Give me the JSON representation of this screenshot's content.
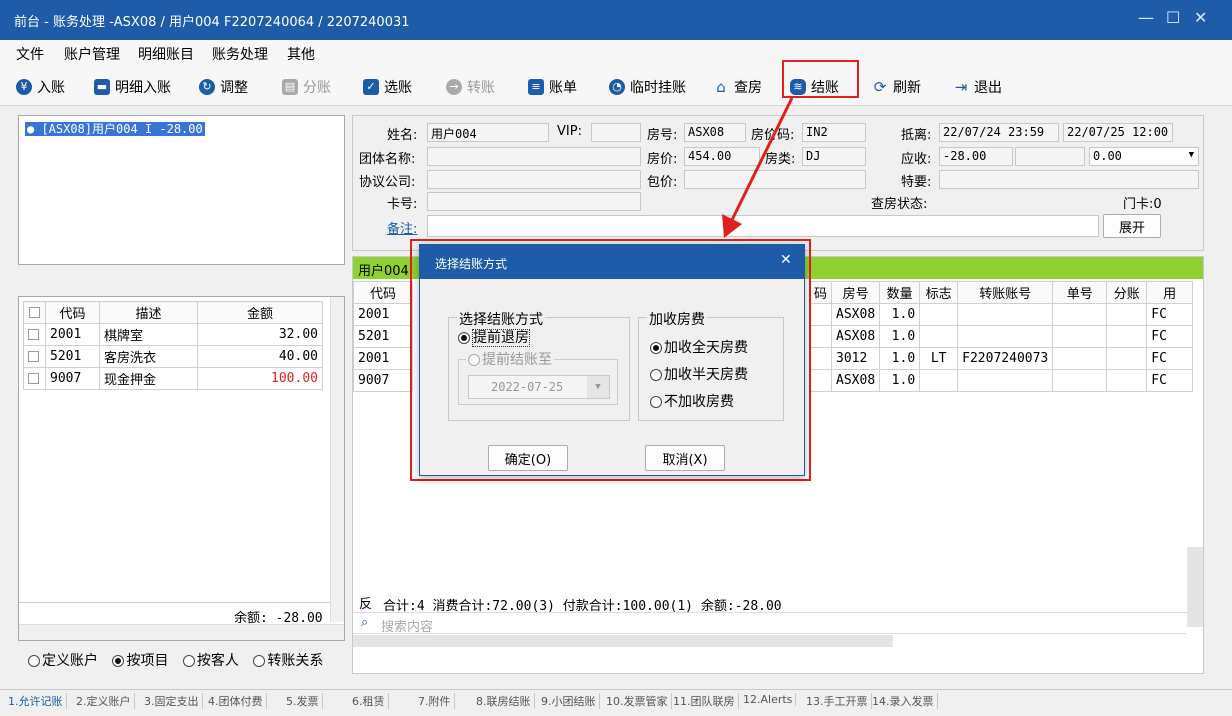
{
  "window": {
    "title": "前台 - 账务处理 -ASX08 / 用户004 F2207240064 / 2207240031",
    "min": "—",
    "max": "☐",
    "close": "✕"
  },
  "menu": [
    "文件",
    "账户管理",
    "明细账目",
    "账务处理",
    "其他"
  ],
  "toolbar": {
    "post": "入账",
    "detail_post": "明细入账",
    "adjust": "调整",
    "split": "分账",
    "select": "选账",
    "transfer": "转账",
    "bill": "账单",
    "temp_hold": "临时挂账",
    "check_room": "查房",
    "checkout": "结账",
    "refresh": "刷新",
    "exit": "退出"
  },
  "account_list": {
    "item": "● [ASX08]用户004         I     -28.00"
  },
  "items_table": {
    "headers": [
      "代码",
      "描述",
      "金额"
    ],
    "rows": [
      {
        "code": "2001",
        "desc": "棋牌室",
        "amount": "32.00"
      },
      {
        "code": "5201",
        "desc": "客房洗衣",
        "amount": "40.00"
      },
      {
        "code": "9007",
        "desc": "现金押金",
        "amount": "100.00"
      }
    ],
    "balance": "余额: -28.00"
  },
  "view_options": [
    "定义账户",
    "按项目",
    "按客人",
    "转账关系"
  ],
  "guest": {
    "name_label": "姓名:",
    "name": "用户004",
    "vip_label": "VIP:",
    "vip": "",
    "room_label": "房号:",
    "room": "ASX08",
    "rate_code_label": "房价码:",
    "rate_code": "IN2",
    "arrival_label": "抵离:",
    "arrival": "22/07/24 23:59",
    "departure": "22/07/25 12:00",
    "group_label": "团体名称:",
    "rate_label": "房价:",
    "rate": "454.00",
    "room_type_label": "房类:",
    "room_type": "DJ",
    "receivable_label": "应收:",
    "receivable": "-28.00",
    "receivable2": "0.00",
    "company_label": "协议公司:",
    "package_label": "包价:",
    "special_label": "特要:",
    "card_label": "卡号:",
    "room_status_label": "查房状态:",
    "door_card": "门卡:0",
    "remark_label": "备注:",
    "expand_button": "展开"
  },
  "transactions": {
    "tab_label": "用户004",
    "headers": [
      "代码",
      "码",
      "房号",
      "数量",
      "标志",
      "转账账号",
      "单号",
      "分账",
      "用"
    ],
    "rows": [
      {
        "code": "2001",
        "room": "ASX08",
        "qty": "1.0",
        "flag": "",
        "transfer": "",
        "end": "FC"
      },
      {
        "code": "5201",
        "room": "ASX08",
        "qty": "1.0",
        "flag": "",
        "transfer": "",
        "end": "FC"
      },
      {
        "code": "2001",
        "room": "3012",
        "qty": "1.0",
        "flag": "LT",
        "transfer": "F2207240073",
        "end": "FC"
      },
      {
        "code": "9007",
        "room": "ASX08",
        "qty": "1.0",
        "flag": "",
        "transfer": "",
        "end": "FC"
      }
    ],
    "summary_prefix": "反",
    "summary": "合计:4  消费合计:72.00(3)  付款合计:100.00(1)  余额:-28.00",
    "search_placeholder": "搜索内容"
  },
  "dialog": {
    "title": "选择结账方式",
    "method_group": "选择结账方式",
    "early_checkout": "提前退房",
    "early_settle": "提前结账至",
    "date": "2022-07-25",
    "fee_group": "加收房费",
    "fee_full": "加收全天房费",
    "fee_half": "加收半天房费",
    "fee_none": "不加收房费",
    "ok": "确定(O)",
    "cancel": "取消(X)"
  },
  "bottom_tabs": [
    "1.允许记账",
    "2.定义账户",
    "3.固定支出",
    "4.团体付费",
    "5.发票",
    "6.租赁",
    "7.附件",
    "8.联房结账",
    "9.小团结账",
    "10.发票管家",
    "11.团队联房",
    "12.Alerts",
    "13.手工开票",
    "14.录入发票"
  ],
  "colors": {
    "title_blue": "#1e5ba8",
    "highlight_red": "#e02020",
    "tab_green": "#8fd032",
    "selection_blue": "#3875d7"
  }
}
